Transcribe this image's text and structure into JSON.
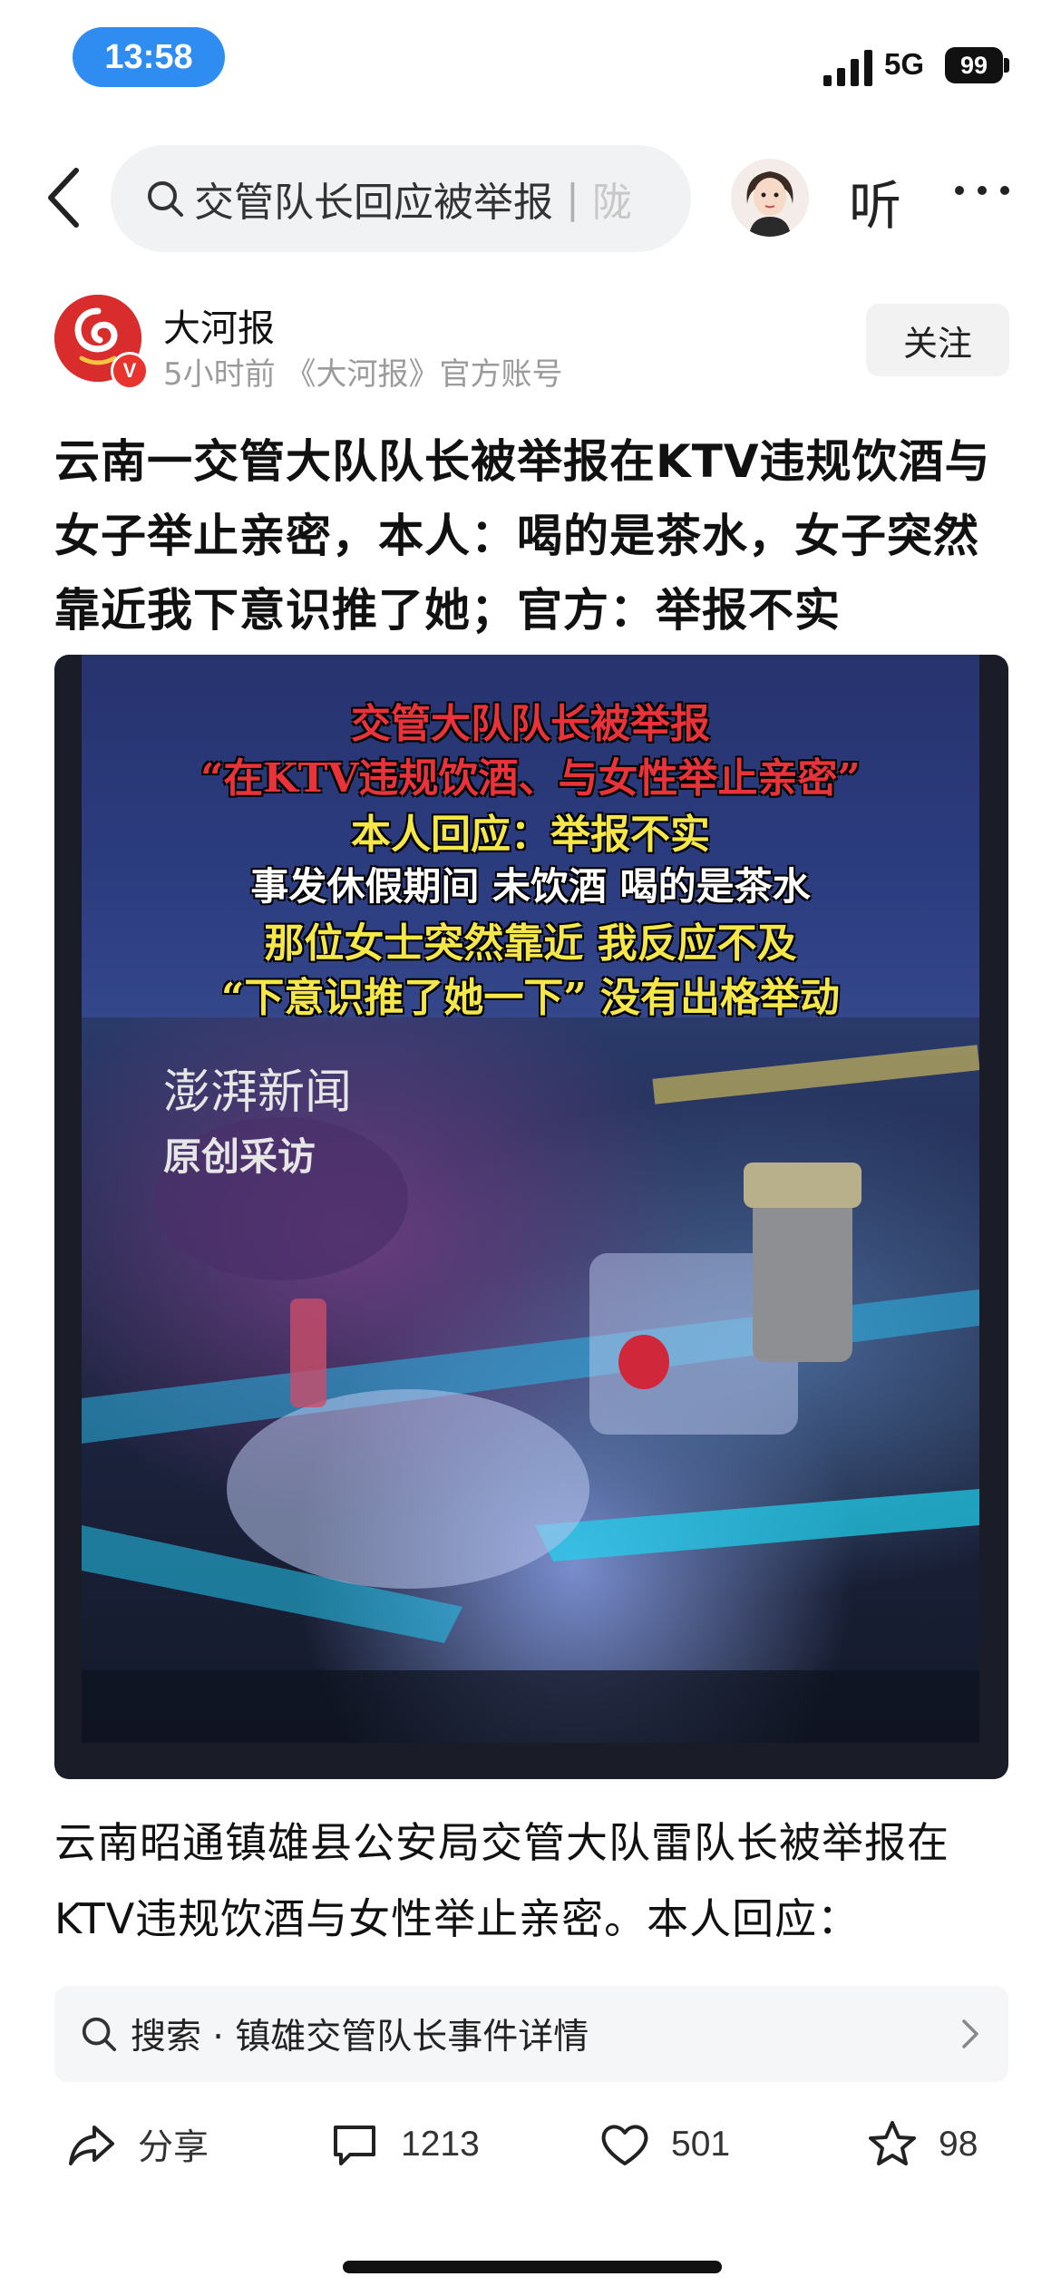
{
  "status_bar": {
    "time": "13:58",
    "network": "5G",
    "battery": "99"
  },
  "nav": {
    "search_query": "交管队长回应被举报",
    "search_separator": "|",
    "search_tail": "陇",
    "listen_label": "听",
    "more_label": "···"
  },
  "author": {
    "name": "大河报",
    "meta": "5小时前 《大河报》官方账号",
    "verified_badge": "V",
    "follow_label": "关注"
  },
  "article": {
    "headline": "云南一交管大队队长被举报在KTV违规饮酒与女子举止亲密，本人：喝的是茶水，女子突然靠近我下意识推了她；官方：举报不实",
    "summary": "云南昭通镇雄县公安局交管大队雷队长被举报在KTV违规饮酒与女性举止亲密。本人回应："
  },
  "media": {
    "overlay_lines": [
      "交管大队队长被举报",
      "“在KTV违规饮酒、与女性举止亲密”",
      "本人回应：举报不实",
      "事发休假期间 未饮酒 喝的是茶水",
      "那位女士突然靠近 我反应不及",
      "“下意识推了她一下” 没有出格举动"
    ],
    "watermark_brand": "澎湃新闻",
    "watermark_sub": "原创采访"
  },
  "suggestion": {
    "text": "搜索 · 镇雄交管队长事件详情"
  },
  "actions": {
    "share_label": "分享",
    "comments_count": "1213",
    "likes_count": "501",
    "favorites_count": "98"
  },
  "colors": {
    "accent_blue": "#2f8cf1",
    "brand_red": "#d92c2c",
    "overlay_red": "#e8333a",
    "overlay_yellow": "#f5e64a"
  },
  "icons": [
    "signal-icon",
    "back-arrow-icon",
    "search-icon",
    "ai-avatar-icon",
    "more-icon",
    "verified-icon",
    "share-icon",
    "comment-icon",
    "heart-icon",
    "star-icon",
    "chevron-right-icon"
  ]
}
